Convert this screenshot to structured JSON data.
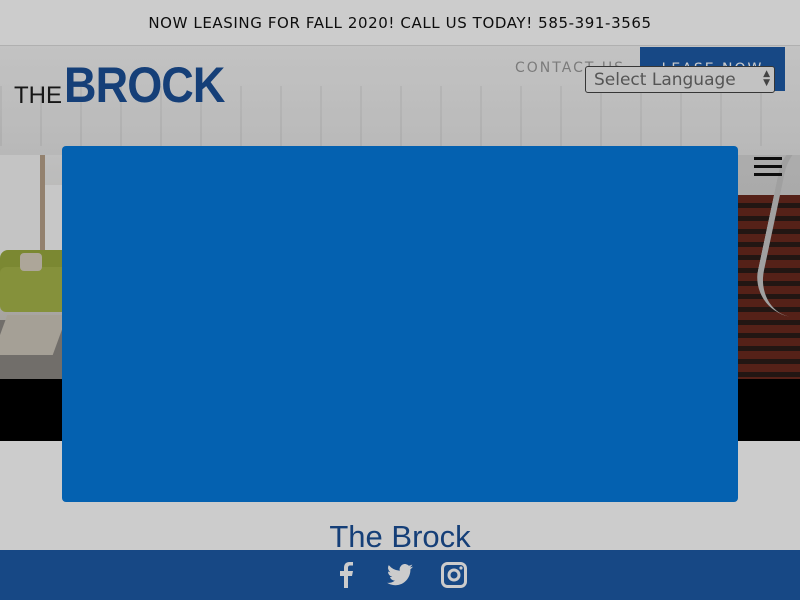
{
  "banner": {
    "text": "NOW LEASING FOR FALL 2020! CALL US TODAY! 585-391-3565"
  },
  "logo": {
    "the": "THE",
    "brock": "BROCK"
  },
  "nav": {
    "contact_label": "CONTACT US",
    "lease_label": "LEASE NOW"
  },
  "language_select": {
    "value": "Select Language"
  },
  "menu": {
    "icon": "hamburger-icon"
  },
  "main": {
    "title": "The Brock"
  },
  "footer": {
    "icons": [
      "facebook-icon",
      "twitter-icon",
      "instagram-icon"
    ]
  },
  "modal": {
    "color": "#0461B0"
  },
  "colors": {
    "brand_blue": "#1B4F96",
    "footer_blue": "#1D5AA7"
  }
}
